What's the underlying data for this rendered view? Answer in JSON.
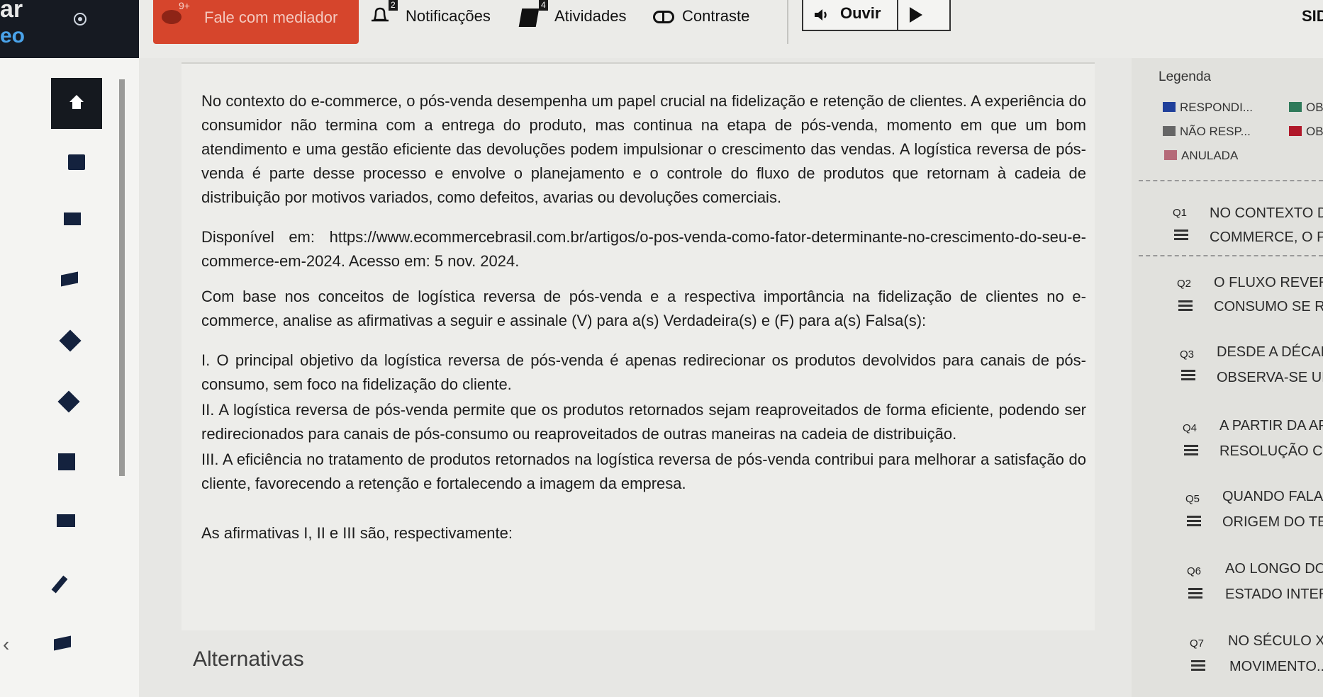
{
  "brand": {
    "line1": "ar",
    "line2": "eo"
  },
  "topbar": {
    "mediator": {
      "label": "Fale com mediador",
      "count": "9+"
    },
    "notifications": {
      "label": "Notificações",
      "count": "2"
    },
    "activities": {
      "label": "Atividades",
      "count": "4"
    },
    "contrast": {
      "label": "Contraste"
    },
    "listen": {
      "label": "Ouvir"
    },
    "user_short": "SID"
  },
  "question": {
    "paragraphs": [
      "No contexto do e-commerce, o pós-venda desempenha um papel crucial na fidelização e retenção de clientes. A experiência do consumidor não termina com a entrega do produto, mas continua na etapa de pós-venda, momento em que um bom atendimento e uma gestão eficiente das devoluções podem impulsionar o crescimento das vendas. A logística reversa de pós-venda é parte desse processo e envolve o planejamento e o controle do fluxo de produtos que retornam à cadeia de distribuição por motivos variados, como defeitos, avarias ou devoluções comerciais.",
      "Disponível em: https://www.ecommercebrasil.com.br/artigos/o-pos-venda-como-fator-determinante-no-crescimento-do-seu-e-commerce-em-2024. Acesso em: 5 nov. 2024.",
      "Com base nos conceitos de logística reversa de pós-venda e a respectiva importância na fidelização de clientes no e-commerce, analise as afirmativas a seguir e assinale (V) para a(s) Verdadeira(s) e (F) para a(s) Falsa(s):",
      "I. O principal objetivo da logística reversa de pós-venda é apenas redirecionar os produtos devolvidos para canais de pós-consumo, sem foco na fidelização do cliente.",
      "II. A logística reversa de pós-venda permite que os produtos retornados sejam reaproveitados de forma eficiente, podendo ser redirecionados para canais de pós-consumo ou reaproveitados de outras maneiras na cadeia de distribuição.",
      "III. A eficiência no tratamento de produtos retornados na logística reversa de pós-venda contribui para melhorar a satisfação do cliente, favorecendo a retenção e fortalecendo a imagem da empresa.",
      "As afirmativas I, II e III são, respectivamente:"
    ],
    "alternatives_title": "Alternativas"
  },
  "legend": {
    "title": "Legenda",
    "items": [
      {
        "label": "RESPONDI...",
        "color": "#1f3f9a"
      },
      {
        "label": "OB",
        "color": "#2f7a5a"
      },
      {
        "label": "NÃO RESP...",
        "color": "#666666"
      },
      {
        "label": "OB",
        "color": "#b0182a"
      },
      {
        "label": "ANULADA",
        "color": "#b56a78"
      }
    ]
  },
  "questions_nav": [
    {
      "num": "Q1",
      "line1": "NO CONTEXTO DO",
      "line2": "COMMERCE, O PÓ"
    },
    {
      "num": "Q2",
      "line1": "O FLUXO REVERSO",
      "line2": "CONSUMO SE REF"
    },
    {
      "num": "Q3",
      "line1": "DESDE A DÉCADA",
      "line2": "OBSERVA-SE UMA"
    },
    {
      "num": "Q4",
      "line1": "A PARTIR DA APR",
      "line2": "RESOLUÇÃO COM"
    },
    {
      "num": "Q5",
      "line1": "QUANDO FALAM",
      "line2": "ORIGEM DO TER"
    },
    {
      "num": "Q6",
      "line1": "AO LONGO DO",
      "line2": "ESTADO INTERV"
    },
    {
      "num": "Q7",
      "line1": "NO SÉCULO XX",
      "line2": "MOVIMENTO..."
    }
  ]
}
